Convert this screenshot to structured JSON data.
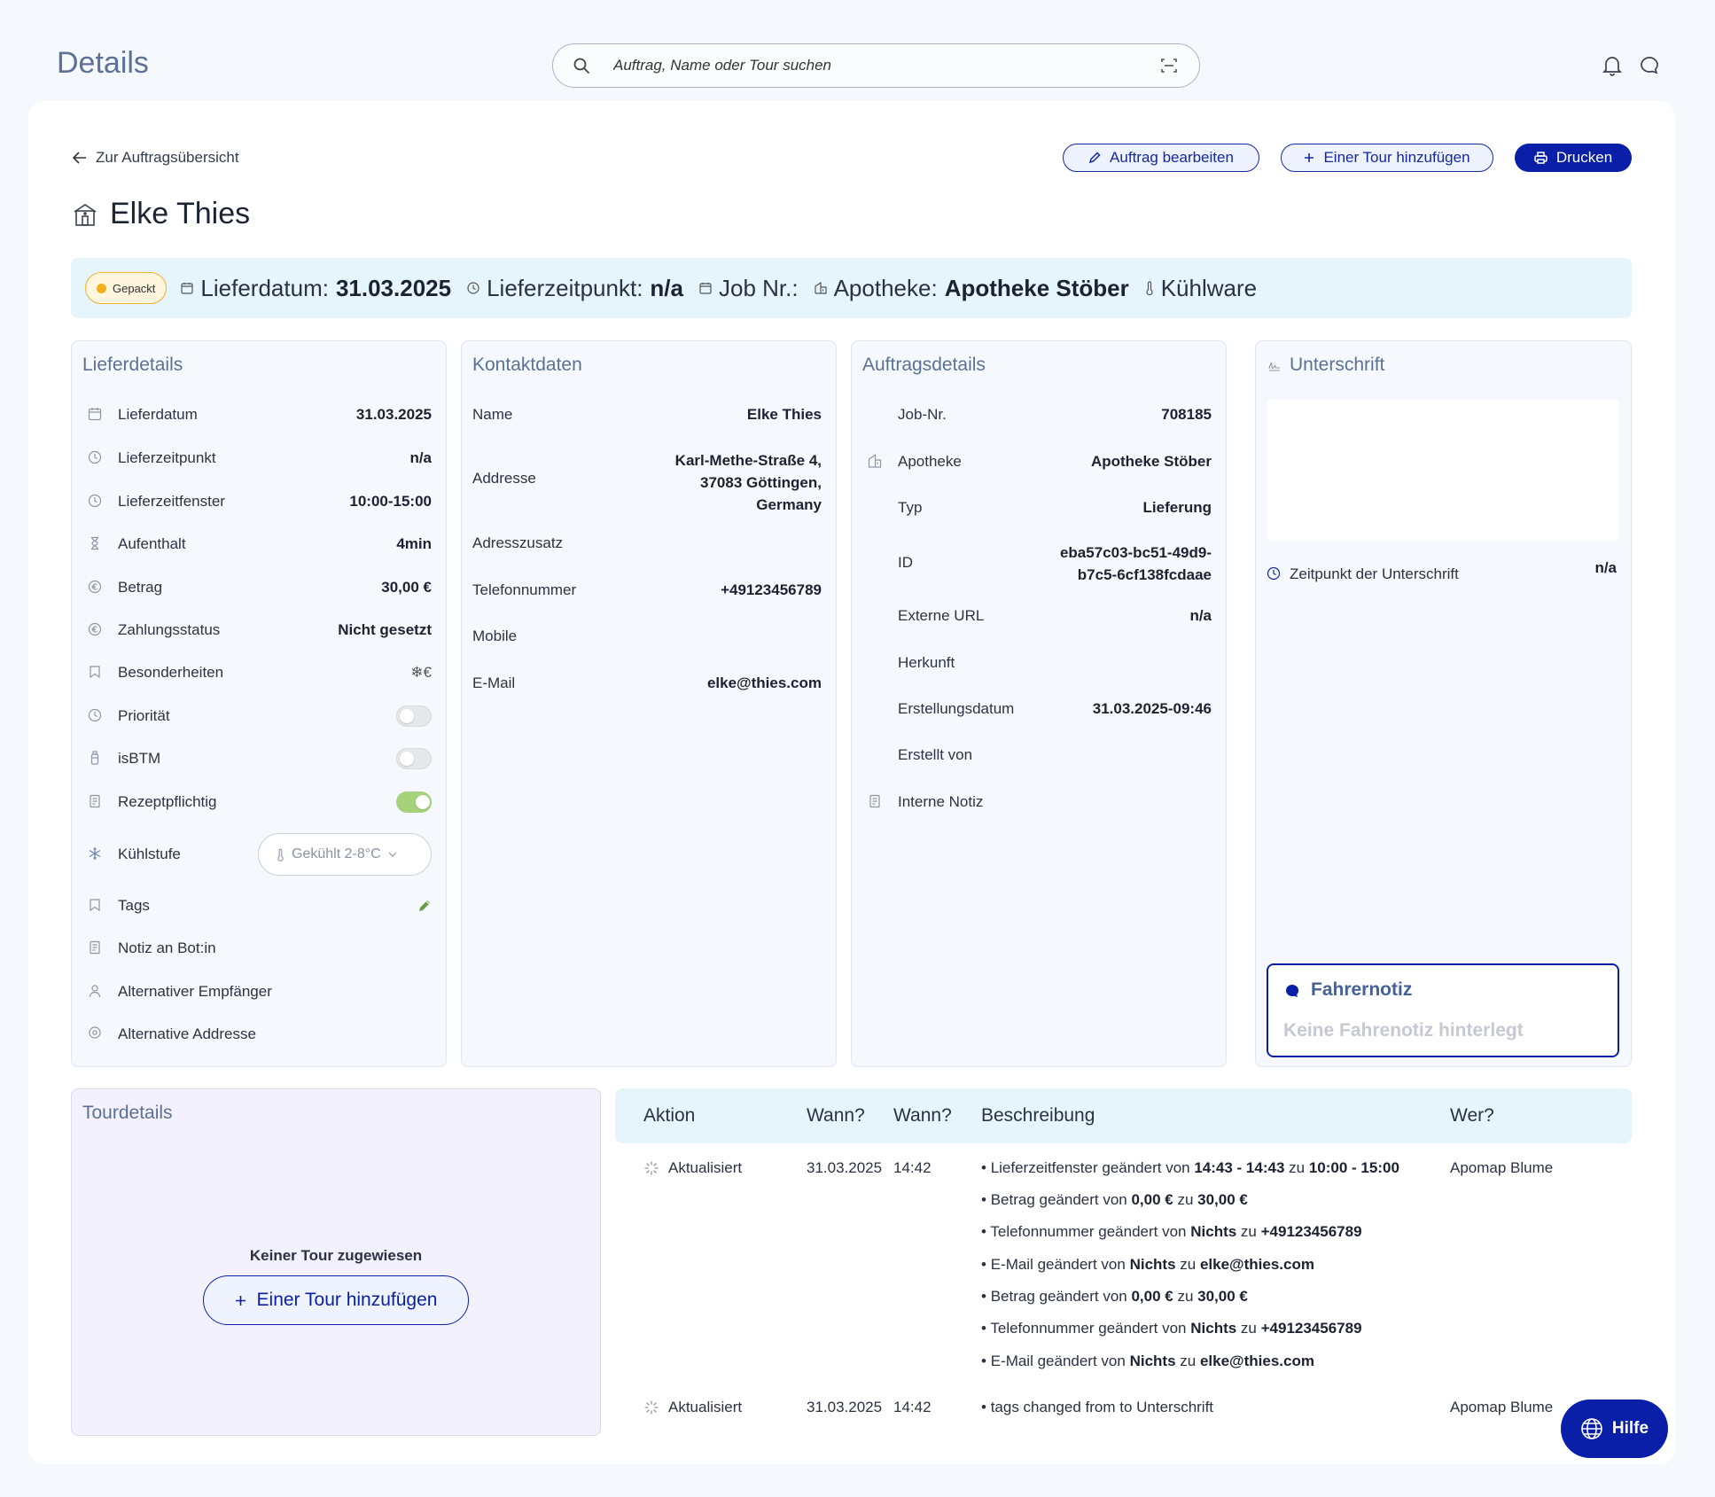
{
  "header": {
    "title": "Details",
    "search_placeholder": "Auftrag, Name oder Tour suchen"
  },
  "toolbar": {
    "back_label": "Zur Auftragsübersicht",
    "edit_label": "Auftrag bearbeiten",
    "add_tour_label": "Einer Tour hinzufügen",
    "print_label": "Drucken"
  },
  "customer_name": "Elke Thies",
  "strip": {
    "status": "Gepackt",
    "status_color": "#f2b01e",
    "lieferdatum_label": "Lieferdatum:",
    "lieferdatum_value": "31.03.2025",
    "lieferzeitpunkt_label": "Lieferzeitpunkt:",
    "lieferzeitpunkt_value": "n/a",
    "jobnr_label": "Job Nr.:",
    "apotheke_label": "Apotheke:",
    "apotheke_value": "Apotheke Stöber",
    "kuehlware": "Kühlware"
  },
  "lieferdetails": {
    "title": "Lieferdetails",
    "rows": [
      {
        "label": "Lieferdatum",
        "value": "31.03.2025",
        "icon": "calendar-icon"
      },
      {
        "label": "Lieferzeitpunkt",
        "value": "n/a",
        "icon": "clock-icon"
      },
      {
        "label": "Lieferzeitfenster",
        "value": "10:00-15:00",
        "icon": "clock-icon"
      },
      {
        "label": "Aufenthalt",
        "value": "4min",
        "icon": "hourglass-icon"
      },
      {
        "label": "Betrag",
        "value": "30,00 €",
        "icon": "euro-icon"
      },
      {
        "label": "Zahlungsstatus",
        "value": "Nicht gesetzt",
        "icon": "euro-icon"
      },
      {
        "label": "Besonderheiten",
        "value": "❄€",
        "icon": "bookmark-icon"
      },
      {
        "label": "Priorität",
        "toggle": false,
        "icon": "clock-icon"
      },
      {
        "label": "isBTM",
        "toggle": false,
        "icon": "bottle-icon"
      },
      {
        "label": "Rezeptpflichtig",
        "toggle": true,
        "icon": "document-icon"
      },
      {
        "label": "Kühlstufe",
        "select": "Gekühlt 2-8°C",
        "icon": "snowflake-icon"
      },
      {
        "label": "Tags",
        "icon": "bookmark-icon"
      },
      {
        "label": "Notiz an Bot:in",
        "icon": "document-icon"
      },
      {
        "label": "Alternativer Empfänger",
        "icon": "person-icon"
      },
      {
        "label": "Alternative Addresse",
        "icon": "location-icon"
      }
    ]
  },
  "kontaktdaten": {
    "title": "Kontaktdaten",
    "rows": [
      {
        "label": "Name",
        "value": "Elke Thies"
      },
      {
        "label": "Addresse",
        "value_lines": [
          "Karl-Methe-Straße 4,",
          "37083 Göttingen,",
          "Germany"
        ]
      },
      {
        "label": "Adresszusatz",
        "value": ""
      },
      {
        "label": "Telefonnummer",
        "value": "+49123456789"
      },
      {
        "label": "Mobile",
        "value": ""
      },
      {
        "label": "E-Mail",
        "value": "elke@thies.com"
      }
    ]
  },
  "auftragsdetails": {
    "title": "Auftragsdetails",
    "rows": [
      {
        "label": "Job-Nr.",
        "value": "708185"
      },
      {
        "label": "Apotheke",
        "value": "Apotheke Stöber"
      },
      {
        "label": "Typ",
        "value": "Lieferung"
      },
      {
        "label": "ID",
        "value_lines": [
          "eba57c03-bc51-49d9-",
          "b7c5-6cf138fcdaae"
        ]
      },
      {
        "label": "Externe URL",
        "value": "n/a"
      },
      {
        "label": "Herkunft",
        "value": ""
      },
      {
        "label": "Erstellungsdatum",
        "value": "31.03.2025-09:46"
      },
      {
        "label": "Erstellt von",
        "value": ""
      },
      {
        "label": "Interne Notiz",
        "value": ""
      }
    ]
  },
  "unterschrift": {
    "title": "Unterschrift",
    "zeitpunkt_label": "Zeitpunkt der Unterschrift",
    "zeitpunkt_value": "n/a",
    "fahrernotiz_title": "Fahrernotiz",
    "fahrernotiz_empty": "Keine Fahrenotiz hinterlegt"
  },
  "tourdetails": {
    "title": "Tourdetails",
    "empty": "Keiner Tour zugewiesen",
    "add_label": "Einer Tour hinzufügen"
  },
  "history": {
    "headers": [
      "Aktion",
      "Wann?",
      "Wann?",
      "Beschreibung",
      "Wer?"
    ],
    "entries": [
      {
        "action": "Aktualisiert",
        "date": "31.03.2025",
        "time": "14:42",
        "who": "Apomap Blume",
        "items": [
          [
            "Lieferzeitfenster geändert von ",
            "14:43 - 14:43",
            " zu ",
            "10:00 - 15:00"
          ],
          [
            "Betrag geändert von ",
            "0,00 €",
            " zu ",
            "30,00 €"
          ],
          [
            "Telefonnummer geändert von ",
            "Nichts",
            " zu ",
            "+49123456789"
          ],
          [
            "E-Mail geändert von ",
            "Nichts",
            " zu ",
            "elke@thies.com"
          ],
          [
            "Betrag geändert von ",
            "0,00 €",
            " zu ",
            "30,00 €"
          ],
          [
            "Telefonnummer geändert von ",
            "Nichts",
            " zu ",
            "+49123456789"
          ],
          [
            "E-Mail geändert von ",
            "Nichts",
            " zu ",
            "elke@thies.com"
          ]
        ]
      },
      {
        "action": "Aktualisiert",
        "date": "31.03.2025",
        "time": "14:42",
        "who": "Apomap Blume",
        "items": [
          [
            "tags changed from to Unterschrift",
            "",
            "",
            ""
          ]
        ]
      }
    ]
  },
  "help_label": "Hilfe"
}
